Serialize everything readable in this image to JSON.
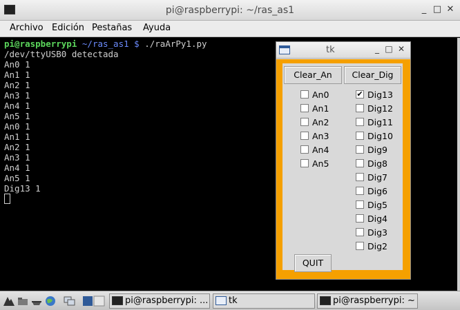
{
  "terminal": {
    "title": "pi@raspberrypi: ~/ras_as1",
    "menu": [
      "Archivo",
      "Edición",
      "Pestañas",
      "Ayuda"
    ],
    "prompt_user": "pi@raspberrypi",
    "prompt_path": "~/ras_as1 $",
    "command": "./raArPy1.py",
    "output_lines": [
      "/dev/ttyUSB0 detectada",
      "An0 1",
      "An1 1",
      "An2 1",
      "An3 1",
      "An4 1",
      "An5 1",
      "An0 1",
      "An1 1",
      "An2 1",
      "An3 1",
      "An4 1",
      "An5 1",
      "Dig13 1"
    ]
  },
  "tk": {
    "title": "tk",
    "clear_an": "Clear_An",
    "clear_dig": "Clear_Dig",
    "analog": [
      {
        "label": "An0",
        "checked": false
      },
      {
        "label": "An1",
        "checked": false
      },
      {
        "label": "An2",
        "checked": false
      },
      {
        "label": "An3",
        "checked": false
      },
      {
        "label": "An4",
        "checked": false
      },
      {
        "label": "An5",
        "checked": false
      }
    ],
    "digital": [
      {
        "label": "Dig13",
        "checked": true
      },
      {
        "label": "Dig12",
        "checked": false
      },
      {
        "label": "Dig11",
        "checked": false
      },
      {
        "label": "Dig10",
        "checked": false
      },
      {
        "label": "Dig9",
        "checked": false
      },
      {
        "label": "Dig8",
        "checked": false
      },
      {
        "label": "Dig7",
        "checked": false
      },
      {
        "label": "Dig6",
        "checked": false
      },
      {
        "label": "Dig5",
        "checked": false
      },
      {
        "label": "Dig4",
        "checked": false
      },
      {
        "label": "Dig3",
        "checked": false
      },
      {
        "label": "Dig2",
        "checked": false
      }
    ],
    "quit": "QUIT",
    "frame_color": "#f5a000"
  },
  "taskbar": {
    "tasks": [
      "pi@raspberrypi: ...",
      "tk",
      "pi@raspberrypi: ~"
    ]
  },
  "controls": {
    "minimize": "_",
    "maximize": "□",
    "close": "✕"
  }
}
